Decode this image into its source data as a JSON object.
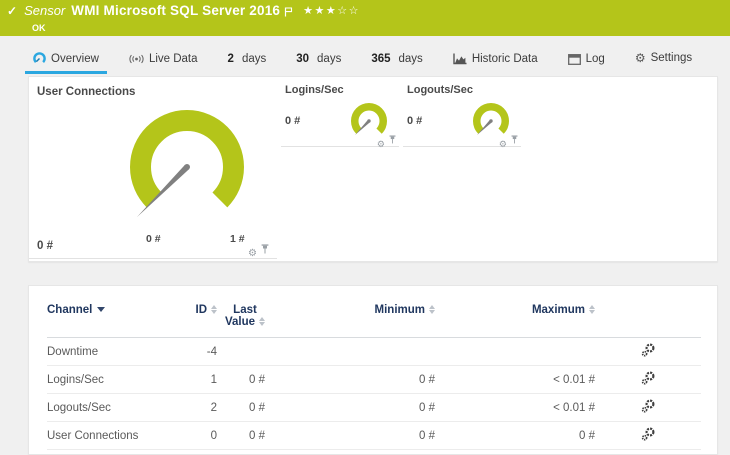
{
  "header": {
    "check_icon": "✓",
    "kind": "Sensor",
    "title": "WMI Microsoft SQL Server 2016",
    "status": "OK",
    "stars_text": "★★★☆☆",
    "stars_filled": 3,
    "stars_total": 5,
    "bg_color": "#b4c51a"
  },
  "tabs": {
    "overview": "Overview",
    "live_data": "Live Data",
    "days2": {
      "num": "2",
      "unit": "days"
    },
    "days30": {
      "num": "30",
      "unit": "days"
    },
    "days365": {
      "num": "365",
      "unit": "days"
    },
    "historic": "Historic Data",
    "log": "Log",
    "settings": "Settings",
    "active_underline_color": "#2ba7e0"
  },
  "gauges": {
    "color": "#b4c51a",
    "needle_color": "#808080",
    "user_connections": {
      "title": "User Connections",
      "value": "0 #",
      "scale_min": "0 #",
      "scale_max": "1 #"
    },
    "logins_sec": {
      "title": "Logins/Sec",
      "value": "0 #"
    },
    "logouts_sec": {
      "title": "Logouts/Sec",
      "value": "0 #"
    }
  },
  "table": {
    "header_text_color": "#20375f",
    "headers": {
      "channel": "Channel",
      "id": "ID",
      "last_value": "Last Value",
      "minimum": "Minimum",
      "maximum": "Maximum"
    },
    "rows": [
      {
        "channel": "Downtime",
        "id": "-4",
        "last": "",
        "min": "",
        "max": ""
      },
      {
        "channel": "Logins/Sec",
        "id": "1",
        "last": "0 #",
        "min": "0 #",
        "max": "< 0.01 #"
      },
      {
        "channel": "Logouts/Sec",
        "id": "2",
        "last": "0 #",
        "min": "0 #",
        "max": "< 0.01 #"
      },
      {
        "channel": "User Connections",
        "id": "0",
        "last": "0 #",
        "min": "0 #",
        "max": "0 #"
      }
    ]
  }
}
